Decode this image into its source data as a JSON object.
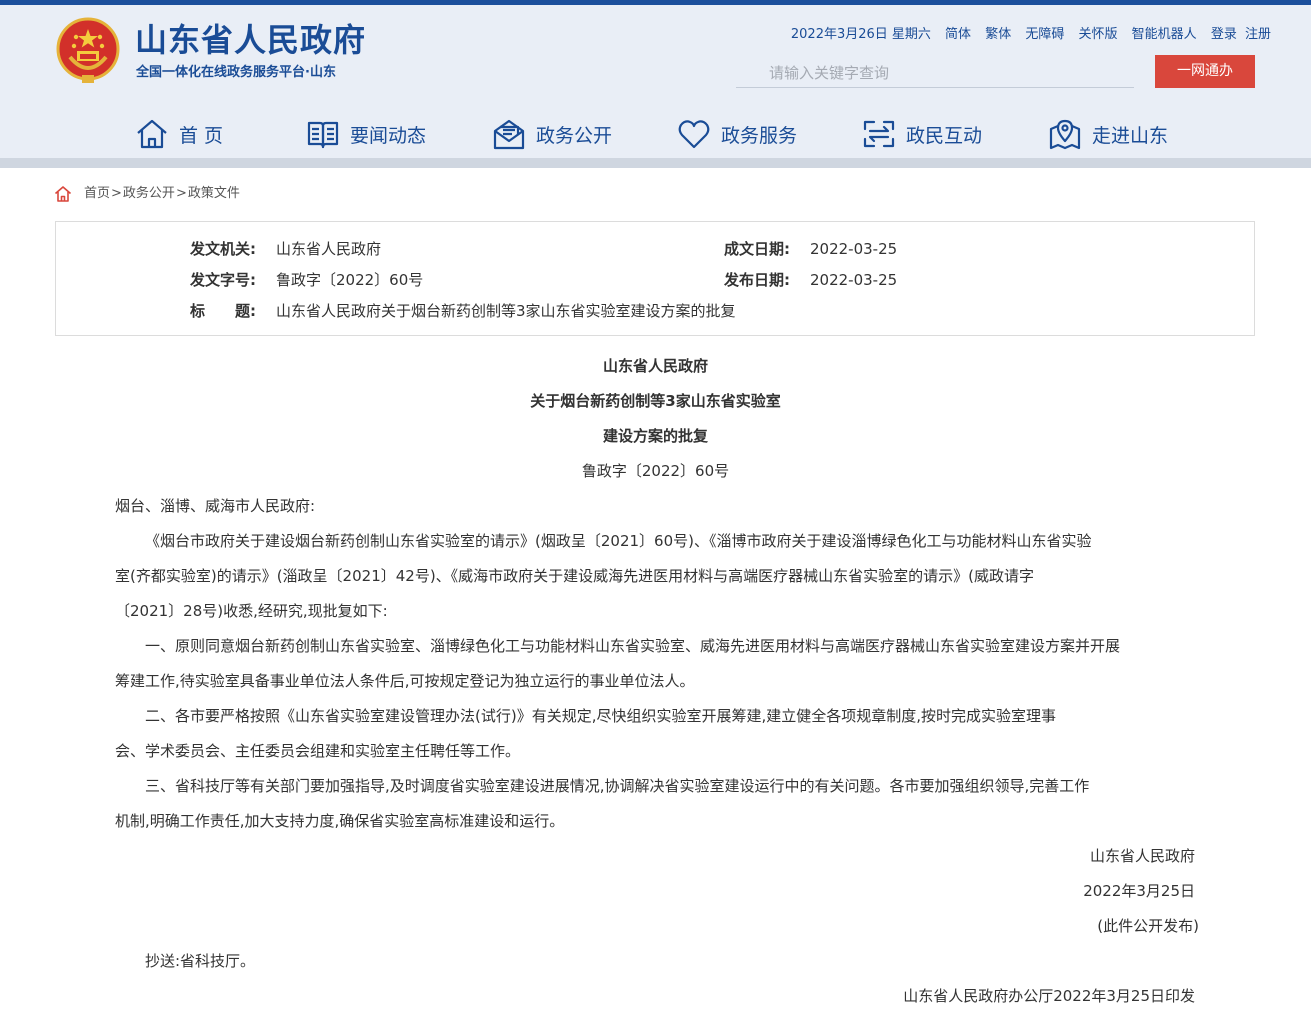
{
  "header": {
    "site_title": "山东省人民政府",
    "site_subtitle": "全国一体化在线政务服务平台·山东",
    "date": "2022年3月26日 星期六",
    "links": [
      "简体",
      "繁体",
      "无障碍",
      "关怀版",
      "智能机器人",
      "登录",
      "注册"
    ],
    "search_placeholder": "请输入关键字查询",
    "login_button": "一网通办",
    "brand_color": "#1a4c96",
    "accent_color": "#d9473c"
  },
  "nav": {
    "items": [
      {
        "label": "首 页",
        "icon": "home-icon"
      },
      {
        "label": "要闻动态",
        "icon": "book-icon"
      },
      {
        "label": "政务公开",
        "icon": "mail-icon"
      },
      {
        "label": "政务服务",
        "icon": "heart-icon"
      },
      {
        "label": "政民互动",
        "icon": "exchange-icon"
      },
      {
        "label": "走进山东",
        "icon": "location-icon"
      }
    ]
  },
  "breadcrumb": {
    "items": [
      "首页",
      "政务公开",
      "政策文件"
    ],
    "separator": ">"
  },
  "meta": {
    "issuer_label": "发文机关:",
    "issuer": "山东省人民政府",
    "created_label": "成文日期:",
    "created": "2022-03-25",
    "doc_no_label": "发文字号:",
    "doc_no": "鲁政字〔2022〕60号",
    "published_label": "发布日期:",
    "published": "2022-03-25",
    "title_label": "标　　题:",
    "title": "山东省人民政府关于烟台新药创制等3家山东省实验室建设方案的批复"
  },
  "document": {
    "heading": [
      "山东省人民政府",
      "关于烟台新药创制等3家山东省实验室",
      "建设方案的批复"
    ],
    "doc_no": "鲁政字〔2022〕60号",
    "addressee": "烟台、淄博、威海市人民政府:",
    "lines": [
      "《烟台市政府关于建设烟台新药创制山东省实验室的请示》(烟政呈〔2021〕60号)、《淄博市政府关于建设淄博绿色化工与功能材料山东省实验",
      "室(齐都实验室)的请示》(淄政呈〔2021〕42号)、《威海市政府关于建设威海先进医用材料与高端医疗器械山东省实验室的请示》(威政请字",
      "〔2021〕28号)收悉,经研究,现批复如下:",
      "一、原则同意烟台新药创制山东省实验室、淄博绿色化工与功能材料山东省实验室、威海先进医用材料与高端医疗器械山东省实验室建设方案并开展",
      "筹建工作,待实验室具备事业单位法人条件后,可按规定登记为独立运行的事业单位法人。",
      "二、各市要严格按照《山东省实验室建设管理办法(试行)》有关规定,尽快组织实验室开展筹建,建立健全各项规章制度,按时完成实验室理事",
      "会、学术委员会、主任委员会组建和实验室主任聘任等工作。",
      "三、省科技厅等有关部门要加强指导,及时调度省实验室建设进展情况,协调解决省实验室建设运行中的有关问题。各市要加强组织领导,完善工作",
      "机制,明确工作责任,加大支持力度,确保省实验室高标准建设和运行。"
    ],
    "signature": "山东省人民政府",
    "sign_date": "2022年3月25日",
    "publish_note": "(此件公开发布)",
    "cc": "抄送:省科技厅。",
    "printed": "山东省人民政府办公厅2022年3月25日印发"
  }
}
